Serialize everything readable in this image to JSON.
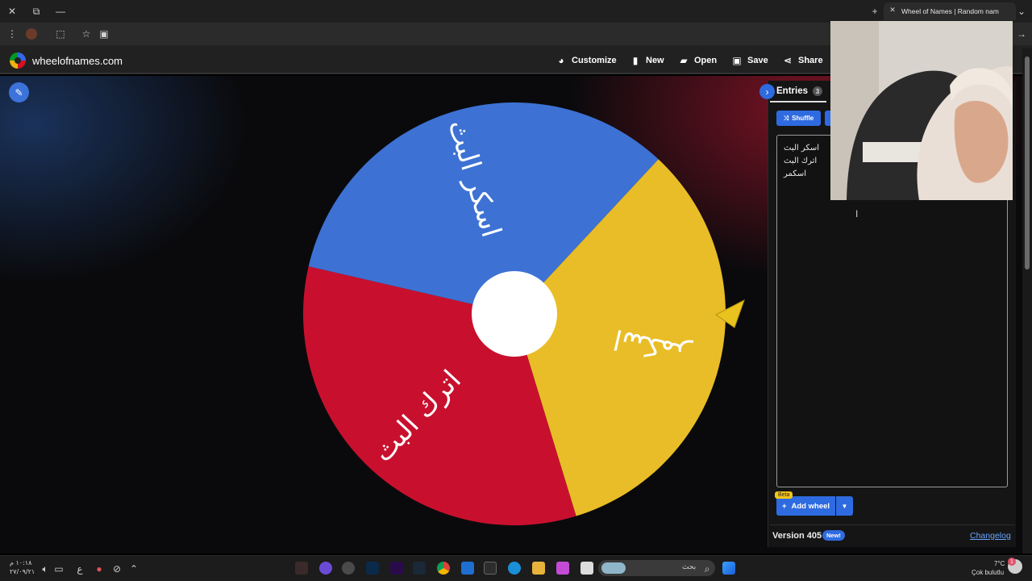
{
  "browser": {
    "tab_title": "Wheel of Names | Random nam",
    "icons": [
      "close-icon",
      "restore-icon",
      "minimize-icon",
      "menu-icon",
      "extension-icon",
      "star-icon",
      "cast-icon",
      "new-tab-icon",
      "tab-close-icon",
      "tab-list-icon",
      "forward-icon"
    ]
  },
  "header": {
    "site_title": "wheelofnames.com",
    "customize": "Customize",
    "new": "New",
    "open": "Open",
    "save": "Save",
    "share": "Share"
  },
  "wheel": {
    "entries": [
      {
        "label": "اسكر البث",
        "color": "#3d72d4"
      },
      {
        "label": "اسكمر",
        "color": "#e9bd27"
      },
      {
        "label": "اترك البث",
        "color": "#c8102e"
      }
    ],
    "pointer_color": "#e9c21f",
    "hub_color": "#ffffff"
  },
  "panel": {
    "entries_tab": "Entries",
    "entries_count": "3",
    "shuffle": "Shuffle",
    "entries_text": [
      "اسكر البث",
      "اترك البث",
      "اسكمر"
    ],
    "beta": "Beta",
    "add_wheel": "Add wheel",
    "version": "Version 405",
    "new_badge": "New!",
    "changelog": "Changelog"
  },
  "taskbar": {
    "time": "١٠:١٨ م",
    "date": "٢٧/٠٩/٢١",
    "search_placeholder": "بحث",
    "temperature": "7°C",
    "weather": "Çok bulutlu",
    "notification_count": "1"
  },
  "colors": {
    "accent": "#2f6be0",
    "header_bg": "#212121",
    "panel_bg": "#151515"
  }
}
